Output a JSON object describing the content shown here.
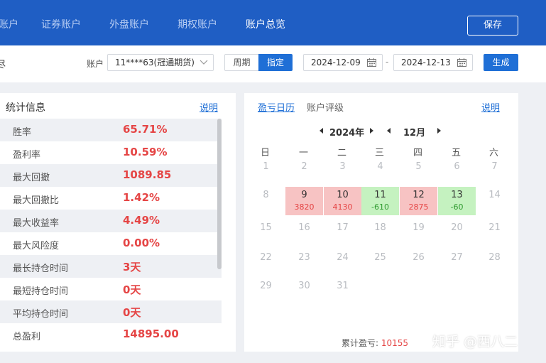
{
  "nav": {
    "tabs": [
      "账户",
      "证券账户",
      "外盘账户",
      "期权账户",
      "账户总览"
    ],
    "active_index": 4,
    "save_label": "保存"
  },
  "filter": {
    "left_label": "尽",
    "account_label": "账户",
    "account_value": "11****63(冠通期货)",
    "period_week": "周期",
    "period_custom": "指定",
    "date_start": "2024-12-09",
    "date_sep": "-",
    "date_end": "2024-12-13",
    "generate_label": "生成"
  },
  "stats": {
    "title": "统计信息",
    "help_link": "说明",
    "rows": [
      {
        "label": "胜率",
        "value": "65.71%"
      },
      {
        "label": "盈利率",
        "value": "10.59%"
      },
      {
        "label": "最大回撤",
        "value": "1089.85"
      },
      {
        "label": "最大回撤比",
        "value": "1.42%"
      },
      {
        "label": "最大收益率",
        "value": "4.49%"
      },
      {
        "label": "最大风险度",
        "value": "0.00%"
      },
      {
        "label": "最长持仓时间",
        "value": "3天"
      },
      {
        "label": "最短持仓时间",
        "value": "0天"
      },
      {
        "label": "平均持仓时间",
        "value": "0天"
      },
      {
        "label": "总盈利",
        "value": "14895.00"
      }
    ]
  },
  "calendar": {
    "tab_active": "盈亏日历",
    "tab_other": "账户评级",
    "help_link": "说明",
    "year": "2024年",
    "month": "12月",
    "weekdays": [
      "日",
      "一",
      "二",
      "三",
      "四",
      "五",
      "六"
    ],
    "days": [
      {
        "day": "1"
      },
      {
        "day": "2"
      },
      {
        "day": "3"
      },
      {
        "day": "4"
      },
      {
        "day": "5"
      },
      {
        "day": "6"
      },
      {
        "day": "7"
      },
      {
        "day": "8"
      },
      {
        "day": "9",
        "pnl": "3820",
        "status": "loss"
      },
      {
        "day": "10",
        "pnl": "4130",
        "status": "loss"
      },
      {
        "day": "11",
        "pnl": "-610",
        "status": "gain"
      },
      {
        "day": "12",
        "pnl": "2875",
        "status": "loss"
      },
      {
        "day": "13",
        "pnl": "-60",
        "status": "gain"
      },
      {
        "day": "14"
      },
      {
        "day": "15"
      },
      {
        "day": "16"
      },
      {
        "day": "17"
      },
      {
        "day": "18"
      },
      {
        "day": "19"
      },
      {
        "day": "20"
      },
      {
        "day": "21"
      },
      {
        "day": "22"
      },
      {
        "day": "23"
      },
      {
        "day": "24"
      },
      {
        "day": "25"
      },
      {
        "day": "26"
      },
      {
        "day": "27"
      },
      {
        "day": "28"
      },
      {
        "day": "29"
      },
      {
        "day": "30"
      },
      {
        "day": "31"
      }
    ],
    "total_label": "累计盈亏:",
    "total_value": "10155"
  },
  "watermark": "知乎 @西八二",
  "colors": {
    "nav_bg": "#1f5ec4",
    "accent": "#1f6fd6",
    "loss_bg": "#f7c3c3",
    "gain_bg": "#c5f2c0",
    "value_red": "#e54545",
    "gain_green": "#2f9a2f"
  }
}
